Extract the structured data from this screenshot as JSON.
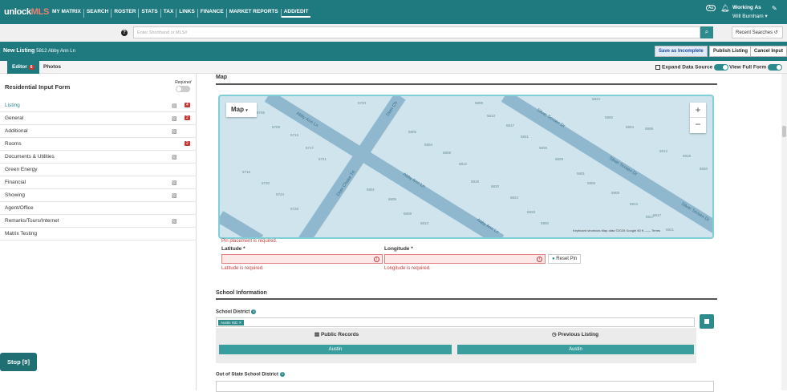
{
  "topnav": {
    "logo_a": "unlock",
    "logo_b": "MLS",
    "links": [
      "MY MATRIX",
      "SEARCH",
      "ROSTER",
      "STATS",
      "TAX",
      "LINKS",
      "FINANCE",
      "MARKET REPORTS",
      "ADD/EDIT"
    ],
    "aa": "Aa",
    "working_as": "Working As",
    "user": "Will Burnham ▾"
  },
  "search": {
    "placeholder": "Enter Shorthand or MLS#",
    "recent": "Recent Searches"
  },
  "listing": {
    "title": "New Listing",
    "address": "5812 Abby Ann Ln",
    "save_incomplete": "Save as Incomplete",
    "publish": "Publish Listing",
    "cancel": "Cancel Input"
  },
  "tabs": {
    "editor": "Editor",
    "editor_badge": "6",
    "photos": "Photos",
    "expand_source": "Expand Data Source",
    "view_full": "View Full Form"
  },
  "sidebar": {
    "title": "Residential Input Form",
    "required": "Required",
    "items": [
      {
        "label": "Listing",
        "badge": "4"
      },
      {
        "label": "General",
        "badge": "2"
      },
      {
        "label": "Additional",
        "badge": ""
      },
      {
        "label": "Rooms",
        "badge": "2"
      },
      {
        "label": "Documents & Utilities",
        "badge": ""
      },
      {
        "label": "Green Energy",
        "badge": ""
      },
      {
        "label": "Financial",
        "badge": ""
      },
      {
        "label": "Showing",
        "badge": ""
      },
      {
        "label": "Agent/Office",
        "badge": ""
      },
      {
        "label": "Remarks/Tours/Internet",
        "badge": ""
      },
      {
        "label": "Matrix Testing",
        "badge": ""
      }
    ],
    "stop": "Stop [9]"
  },
  "map": {
    "section": "Map",
    "type_btn": "Map",
    "zoom_in": "+",
    "zoom_out": "−",
    "attribution": "Keyboard shortcuts   Map data ©2025 Google   50 ft ——   Terms",
    "streets": [
      "Abby Ann Ln",
      "Abby Ann Ln",
      "Abby Ann Ln",
      "Silver Screen Dr",
      "Silver Screen Dr",
      "Silver Screen Dr",
      "Deer Chase Trl",
      "Deer Ch"
    ],
    "addr": [
      "5720",
      "5705",
      "5709",
      "5713",
      "5717",
      "5721",
      "5716",
      "5720",
      "5724",
      "5728",
      "5809",
      "5813",
      "5817",
      "5821",
      "5825",
      "5829",
      "5805",
      "5804",
      "5808",
      "5812",
      "5816",
      "5820",
      "5824",
      "5828",
      "5801",
      "5805",
      "5809",
      "5813",
      "5817",
      "5824",
      "5900",
      "5904",
      "5908",
      "5912",
      "5916",
      "5920",
      "5901",
      "5905",
      "5909",
      "5913",
      "5917",
      "5921",
      "5900"
    ]
  },
  "pin": {
    "error": "Pin placement is required.",
    "lat_label": "Latitude *",
    "lat_error": "Latitude is required.",
    "lon_label": "Longitude *",
    "lon_error": "Longitude is required.",
    "reset": "Reset Pin"
  },
  "school": {
    "section": "School Information",
    "district_label": "School District",
    "tag": "Austin ISD",
    "public_records": "Public Records",
    "previous_listing": "Previous Listing",
    "public_value": "Austin",
    "previous_value": "Austin",
    "oos_label": "Out of State School District"
  }
}
